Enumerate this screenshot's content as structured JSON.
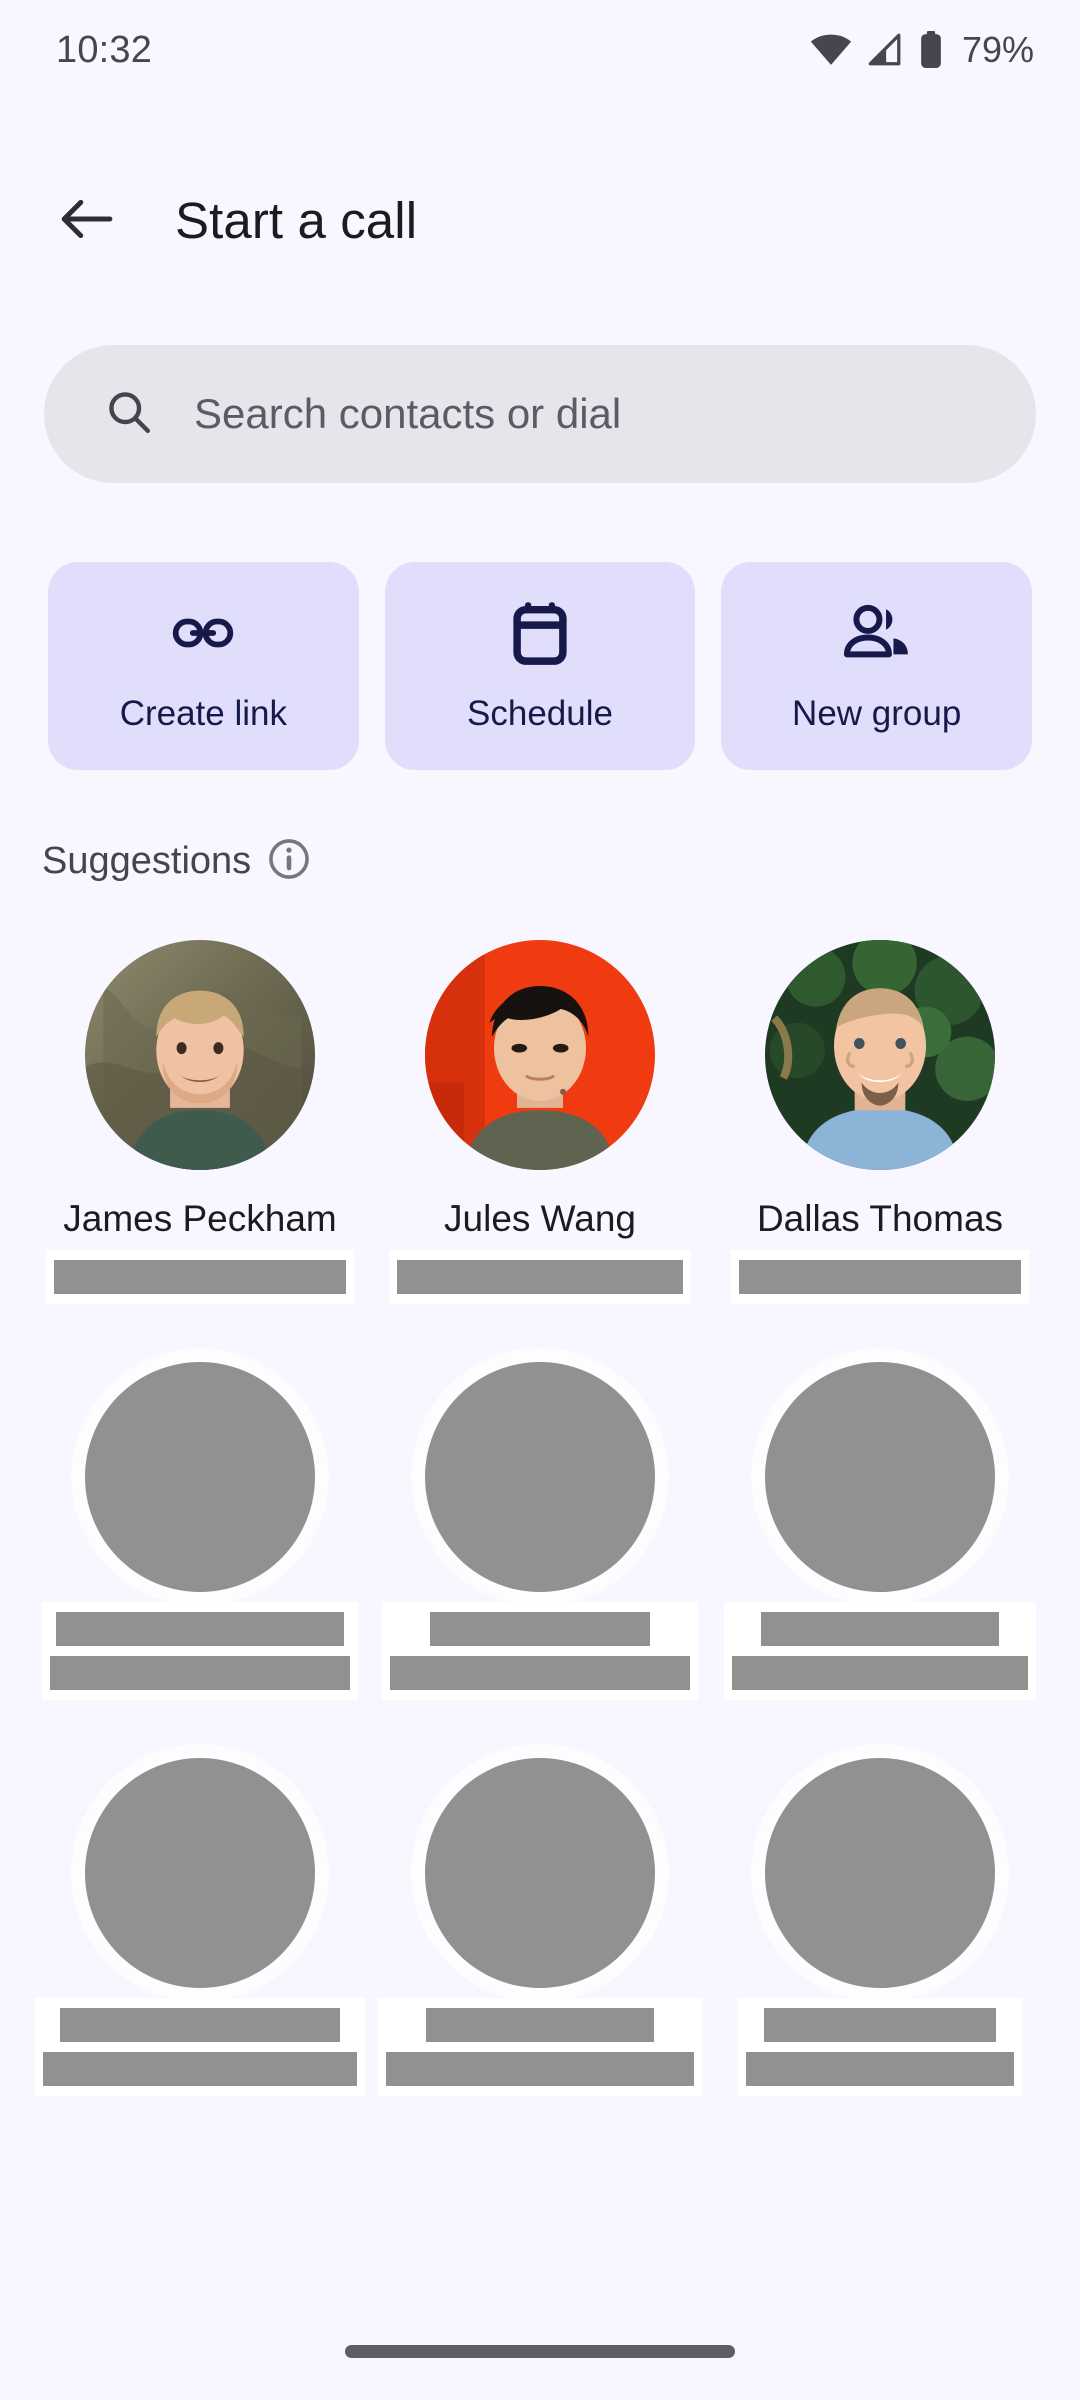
{
  "status_bar": {
    "time": "10:32",
    "battery_percent": "79%",
    "wifi_icon": "wifi-icon",
    "cellular_icon": "cellular-signal-icon",
    "battery_icon": "battery-icon"
  },
  "header": {
    "back_icon": "back-arrow-icon",
    "title": "Start a call"
  },
  "search": {
    "icon": "search-icon",
    "placeholder": "Search contacts or dial",
    "value": ""
  },
  "actions": [
    {
      "label": "Create link",
      "icon": "link-icon"
    },
    {
      "label": "Schedule",
      "icon": "calendar-icon"
    },
    {
      "label": "New group",
      "icon": "people-group-icon"
    }
  ],
  "suggestions": {
    "title": "Suggestions",
    "info_icon": "info-icon"
  },
  "contacts": [
    {
      "name": "James Peckham",
      "redacted": false,
      "avatar": "photo-man-green-sweater"
    },
    {
      "name": "Jules Wang",
      "redacted": false,
      "avatar": "photo-man-red-background"
    },
    {
      "name": "Dallas Thomas",
      "redacted": false,
      "avatar": "photo-man-blue-shirt"
    },
    {
      "name": "",
      "redacted": true,
      "avatar": "placeholder-avatar"
    },
    {
      "name": "",
      "redacted": true,
      "avatar": "placeholder-avatar"
    },
    {
      "name": "",
      "redacted": true,
      "avatar": "placeholder-avatar"
    },
    {
      "name": "",
      "redacted": true,
      "avatar": "placeholder-avatar"
    },
    {
      "name": "",
      "redacted": true,
      "avatar": "placeholder-avatar"
    },
    {
      "name": "",
      "redacted": true,
      "avatar": "placeholder-avatar"
    }
  ],
  "nav": {
    "gesture_bar": "home-gesture-bar"
  },
  "colors": {
    "background": "#F8F6FE",
    "search_bg": "#E7E5EB",
    "action_bg": "#E0DEFB",
    "action_fg": "#17194A",
    "text_primary": "#1C1B20",
    "text_secondary": "#49454F",
    "redaction": "#919191"
  }
}
